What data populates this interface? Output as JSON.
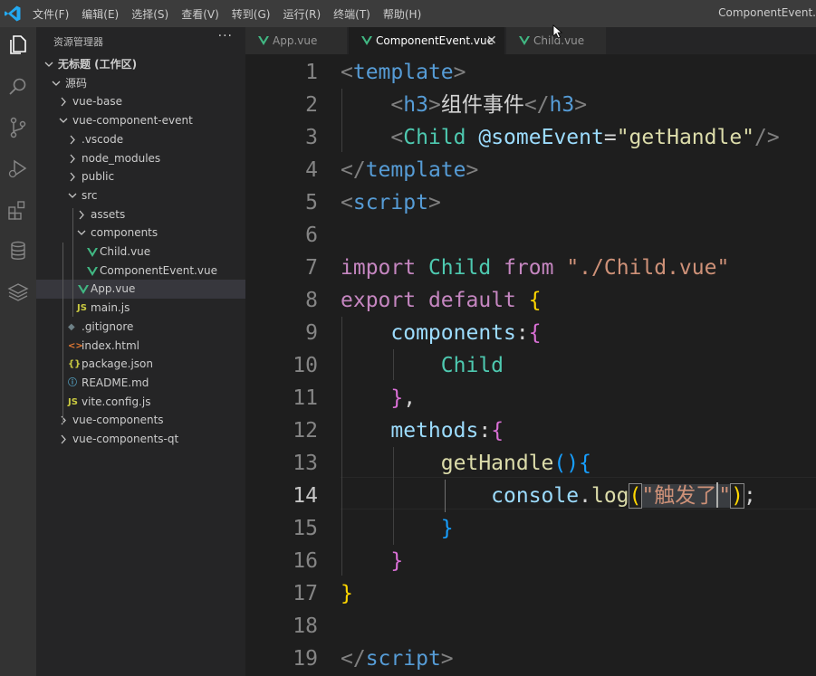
{
  "window": {
    "title": "ComponentEvent."
  },
  "menu": [
    "文件(F)",
    "编辑(E)",
    "选择(S)",
    "查看(V)",
    "转到(G)",
    "运行(R)",
    "终端(T)",
    "帮助(H)"
  ],
  "activity_icons": [
    "explorer-icon",
    "search-icon",
    "source-control-icon",
    "run-debug-icon",
    "extensions-icon",
    "database-icon",
    "layers-icon"
  ],
  "sidebar": {
    "title": "资源管理器",
    "more": "···",
    "tree": [
      {
        "label": "无标题 (工作区)",
        "depth": 0,
        "kind": "folder",
        "open": true,
        "bold": true
      },
      {
        "label": "源码",
        "depth": 1,
        "kind": "folder",
        "open": true
      },
      {
        "label": "vue-base",
        "depth": 2,
        "kind": "folder",
        "open": false
      },
      {
        "label": "vue-component-event",
        "depth": 2,
        "kind": "folder",
        "open": true
      },
      {
        "label": ".vscode",
        "depth": 3,
        "kind": "folder",
        "open": false
      },
      {
        "label": "node_modules",
        "depth": 3,
        "kind": "folder",
        "open": false
      },
      {
        "label": "public",
        "depth": 3,
        "kind": "folder",
        "open": false
      },
      {
        "label": "src",
        "depth": 3,
        "kind": "folder",
        "open": true
      },
      {
        "label": "assets",
        "depth": 4,
        "kind": "folder",
        "open": false
      },
      {
        "label": "components",
        "depth": 4,
        "kind": "folder",
        "open": true
      },
      {
        "label": "Child.vue",
        "depth": 5,
        "kind": "vue"
      },
      {
        "label": "ComponentEvent.vue",
        "depth": 5,
        "kind": "vue"
      },
      {
        "label": "App.vue",
        "depth": 4,
        "kind": "vue",
        "selected": true
      },
      {
        "label": "main.js",
        "depth": 4,
        "kind": "js",
        "icon": "JS"
      },
      {
        "label": ".gitignore",
        "depth": 3,
        "kind": "git",
        "icon": "◆"
      },
      {
        "label": "index.html",
        "depth": 3,
        "kind": "html",
        "icon": "<>"
      },
      {
        "label": "package.json",
        "depth": 3,
        "kind": "json",
        "icon": "{}"
      },
      {
        "label": "README.md",
        "depth": 3,
        "kind": "info",
        "icon": "ⓘ"
      },
      {
        "label": "vite.config.js",
        "depth": 3,
        "kind": "js",
        "icon": "JS"
      },
      {
        "label": "vue-components",
        "depth": 2,
        "kind": "folder",
        "open": false
      },
      {
        "label": "vue-components-qt",
        "depth": 2,
        "kind": "folder",
        "open": false
      }
    ]
  },
  "tabs": [
    {
      "label": "App.vue",
      "active": false
    },
    {
      "label": "ComponentEvent.vue",
      "active": true,
      "close": "✕"
    },
    {
      "label": "Child.vue",
      "active": false
    }
  ],
  "editor": {
    "current_line": 14,
    "line_numbers": [
      "1",
      "2",
      "3",
      "4",
      "5",
      "6",
      "7",
      "8",
      "9",
      "10",
      "11",
      "12",
      "13",
      "14",
      "15",
      "16",
      "17",
      "18",
      "19"
    ],
    "code": {
      "l1": {
        "lt": "<",
        "tag": "template",
        "gt": ">"
      },
      "l2": {
        "indent": "    ",
        "lt": "<",
        "tag": "h3",
        "gt": ">",
        "text": "组件事件",
        "clt": "</",
        "ctag": "h3",
        "cgt": ">"
      },
      "l3": {
        "indent": "    ",
        "lt": "<",
        "tag": "Child",
        "sp": " ",
        "attr": "@someEvent",
        "eq": "=",
        "val": "\"getHandle\"",
        "end": "/>"
      },
      "l4": {
        "lt": "</",
        "tag": "template",
        "gt": ">"
      },
      "l5": {
        "lt": "<",
        "tag": "script",
        "gt": ">"
      },
      "l7": {
        "kw1": "import",
        "sp1": " ",
        "name": "Child",
        "sp2": " ",
        "kw2": "from",
        "sp3": " ",
        "str": "\"./Child.vue\""
      },
      "l8": {
        "kw1": "export",
        "sp1": " ",
        "kw2": "default",
        "sp2": " ",
        "brace": "{"
      },
      "l9": {
        "indent": "    ",
        "prop": "components",
        "colon": ":",
        "brace": "{"
      },
      "l10": {
        "indent": "        ",
        "name": "Child"
      },
      "l11": {
        "indent": "    ",
        "brace": "}",
        "comma": ","
      },
      "l12": {
        "indent": "    ",
        "prop": "methods",
        "colon": ":",
        "brace": "{"
      },
      "l13": {
        "indent": "        ",
        "fn": "getHandle",
        "paren": "()",
        "brace": "{"
      },
      "l14": {
        "indent": "            ",
        "obj": "console",
        "dot": ".",
        "fn": "log",
        "po": "(",
        "q1": "\"",
        "str": "触发了",
        "q2": "\"",
        "pc": ")",
        "semi": ";"
      },
      "l15": {
        "indent": "        ",
        "brace": "}"
      },
      "l16": {
        "indent": "    ",
        "brace": "}"
      },
      "l17": {
        "brace": "}"
      },
      "l19": {
        "lt": "</",
        "tag": "script",
        "gt": ">"
      }
    }
  },
  "colors": {
    "accent": "#007acc",
    "vue_green": "#41b883",
    "js_yellow": "#cbcb41"
  }
}
